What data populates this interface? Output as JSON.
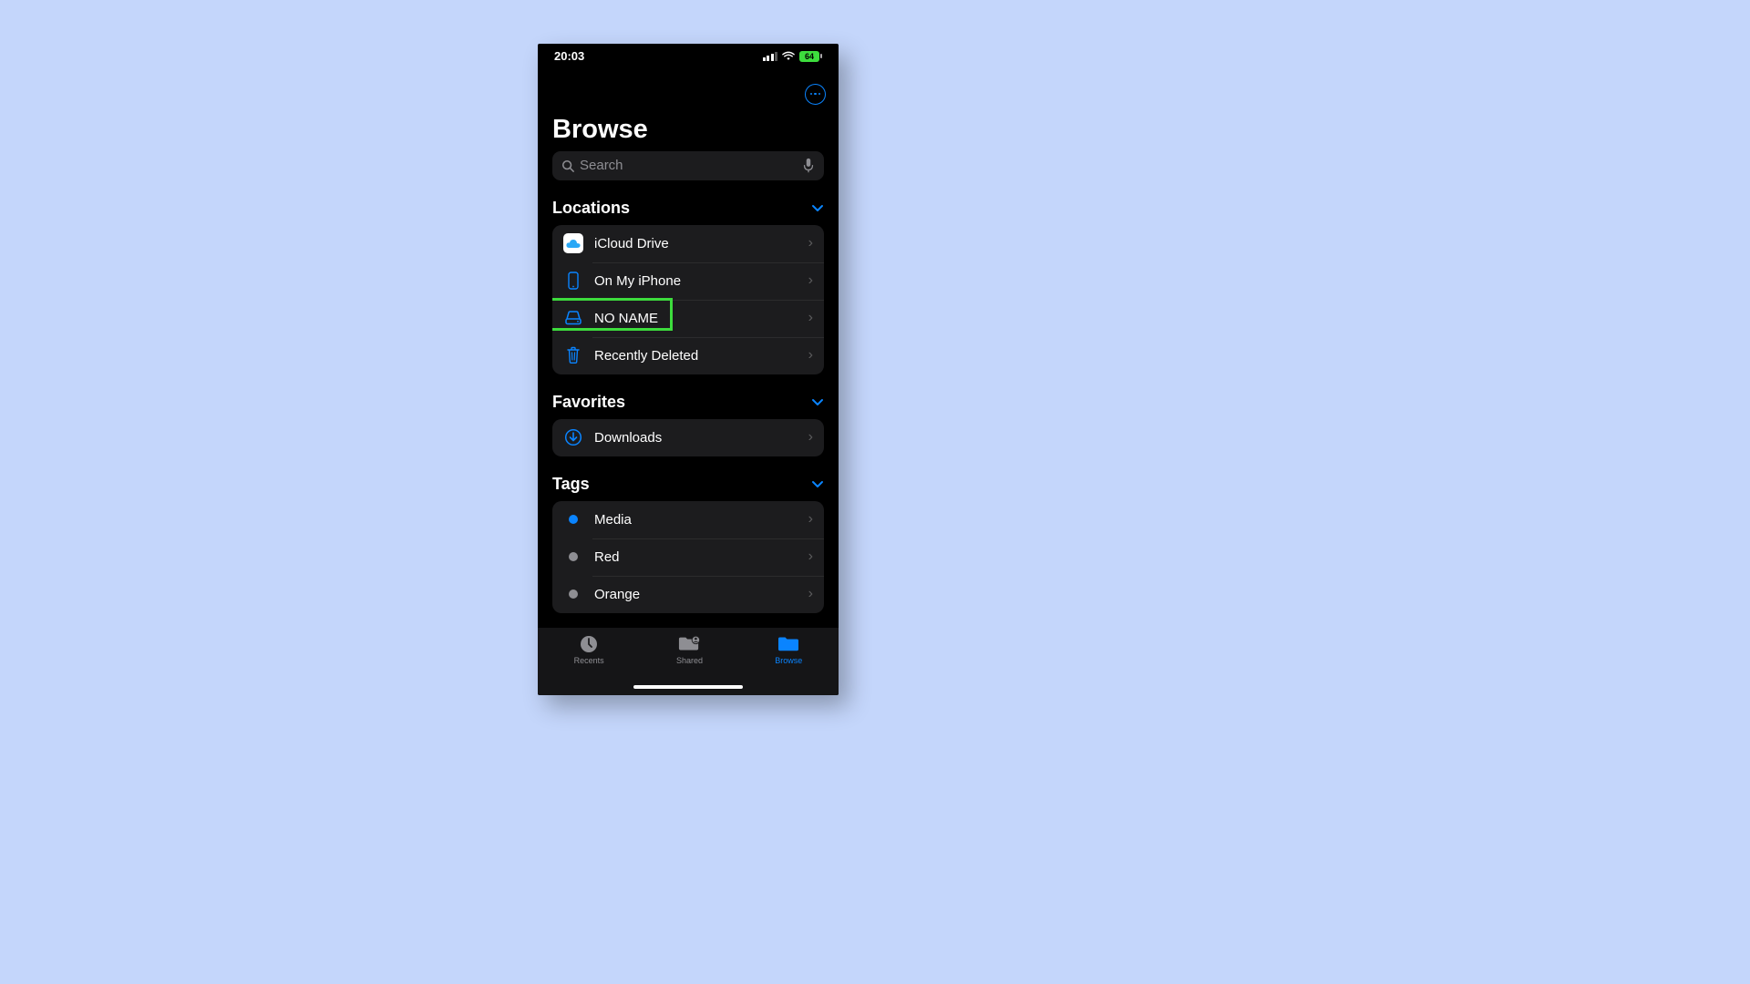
{
  "status": {
    "time": "20:03",
    "battery": "64"
  },
  "header": {
    "title": "Browse"
  },
  "search": {
    "placeholder": "Search"
  },
  "sections": {
    "locations": {
      "title": "Locations",
      "items": [
        {
          "label": "iCloud Drive"
        },
        {
          "label": "On My iPhone"
        },
        {
          "label": "NO NAME"
        },
        {
          "label": "Recently Deleted"
        }
      ]
    },
    "favorites": {
      "title": "Favorites",
      "items": [
        {
          "label": "Downloads"
        }
      ]
    },
    "tags": {
      "title": "Tags",
      "items": [
        {
          "label": "Media",
          "color": "#0a84ff"
        },
        {
          "label": "Red",
          "color": "#8e8e93"
        },
        {
          "label": "Orange",
          "color": "#8e8e93"
        }
      ]
    }
  },
  "tabs": {
    "recents": "Recents",
    "shared": "Shared",
    "browse": "Browse"
  },
  "colors": {
    "accent": "#0a84ff",
    "highlight": "#3ddc3d"
  }
}
